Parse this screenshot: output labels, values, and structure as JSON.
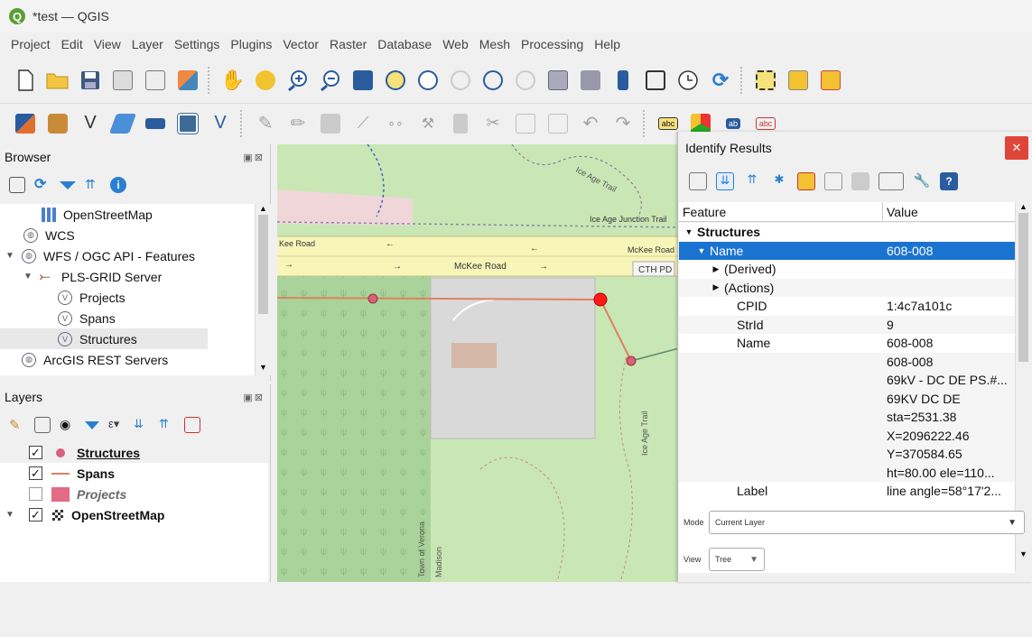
{
  "window": {
    "title": "*test — QGIS",
    "logo_letter": "Q"
  },
  "menu": [
    "Project",
    "Edit",
    "View",
    "Layer",
    "Settings",
    "Plugins",
    "Vector",
    "Raster",
    "Database",
    "Web",
    "Mesh",
    "Processing",
    "Help"
  ],
  "browser": {
    "title": "Browser",
    "items": [
      {
        "label": "OpenStreetMap",
        "icon": "grid-icon"
      },
      {
        "label": "WCS",
        "icon": "globe-icon"
      },
      {
        "label": "WFS / OGC API - Features",
        "icon": "globe-icon"
      },
      {
        "label": "PLS-GRID Server",
        "icon": "connection-icon"
      },
      {
        "label": "Projects",
        "icon": "wfs-icon"
      },
      {
        "label": "Spans",
        "icon": "wfs-icon"
      },
      {
        "label": "Structures",
        "icon": "wfs-icon"
      },
      {
        "label": "ArcGIS REST Servers",
        "icon": "globe-icon"
      }
    ]
  },
  "layers": {
    "title": "Layers",
    "items": [
      {
        "label": "Structures",
        "checked": true,
        "symbol": "point",
        "color": "#d9607a"
      },
      {
        "label": "Spans",
        "checked": true,
        "symbol": "line",
        "color": "#e08060"
      },
      {
        "label": "Projects",
        "checked": false,
        "symbol": "polygon",
        "color": "#e46a86"
      },
      {
        "label": "OpenStreetMap",
        "checked": true,
        "symbol": "raster",
        "color": "#333333"
      }
    ]
  },
  "map": {
    "labels": {
      "ice_age_trail_top": "Ice Age Trail",
      "ice_age_junction": "Ice Age Junction Trail",
      "kee_road": "Kee Road",
      "mckee_road_1": "McKee Road",
      "mckee_road_2": "McKee Road",
      "cth_pd": "CTH PD",
      "ice_age_trail_side": "Ice Age Trail",
      "town_of_verona": "Town of Verona",
      "madison": "Madison"
    }
  },
  "identify": {
    "title": "Identify Results",
    "columns": {
      "feature": "Feature",
      "value": "Value"
    },
    "rows": [
      {
        "feature": "Structures",
        "value": "",
        "indent": 0,
        "arrow": "▼",
        "bold": true,
        "style": "w"
      },
      {
        "feature": "Name",
        "value": "608-008",
        "indent": 1,
        "arrow": "▼",
        "bold": false,
        "style": "sel"
      },
      {
        "feature": "(Derived)",
        "value": "",
        "indent": 2,
        "arrow": "▶",
        "bold": false,
        "style": "w"
      },
      {
        "feature": "(Actions)",
        "value": "",
        "indent": 2,
        "arrow": "▶",
        "bold": false,
        "style": "alt"
      },
      {
        "feature": "CPID",
        "value": "1:4c7a101c",
        "indent": 2,
        "arrow": "",
        "bold": false,
        "style": "w"
      },
      {
        "feature": "StrId",
        "value": "9",
        "indent": 2,
        "arrow": "",
        "bold": false,
        "style": "alt"
      },
      {
        "feature": "Name",
        "value": "608-008",
        "indent": 2,
        "arrow": "",
        "bold": false,
        "style": "w"
      },
      {
        "feature": "",
        "value": "608-008",
        "indent": 2,
        "arrow": "",
        "bold": false,
        "style": "alt"
      },
      {
        "feature": "",
        "value": "69kV - DC DE PS.#...",
        "indent": 2,
        "arrow": "",
        "bold": false,
        "style": "alt"
      },
      {
        "feature": "",
        "value": "69KV DC DE",
        "indent": 2,
        "arrow": "",
        "bold": false,
        "style": "alt"
      },
      {
        "feature": "",
        "value": "sta=2531.38",
        "indent": 2,
        "arrow": "",
        "bold": false,
        "style": "alt"
      },
      {
        "feature": "",
        "value": "X=2096222.46",
        "indent": 2,
        "arrow": "",
        "bold": false,
        "style": "alt"
      },
      {
        "feature": "",
        "value": "Y=370584.65",
        "indent": 2,
        "arrow": "",
        "bold": false,
        "style": "alt"
      },
      {
        "feature": "",
        "value": "ht=80.00 ele=110...",
        "indent": 2,
        "arrow": "",
        "bold": false,
        "style": "alt"
      },
      {
        "feature": "Label",
        "value": "line angle=58°17'2...",
        "indent": 2,
        "arrow": "",
        "bold": false,
        "style": "w"
      }
    ],
    "mode": {
      "label": "Mode",
      "value": "Current Layer"
    },
    "view": {
      "label": "View",
      "value": "Tree"
    }
  },
  "colors": {
    "selection": "#1b73d1",
    "close": "#e0453a",
    "map_green": "#c9e7b5",
    "road": "#f7f5b8"
  }
}
